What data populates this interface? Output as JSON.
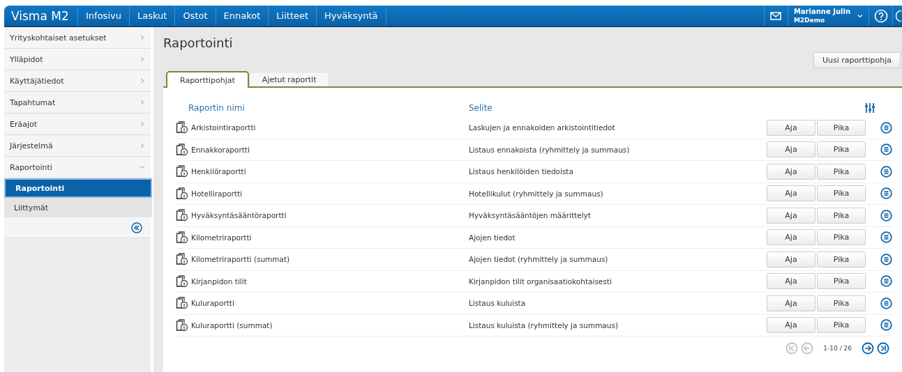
{
  "brand": "Visma M2",
  "nav": [
    {
      "label": "Infosivu"
    },
    {
      "label": "Laskut"
    },
    {
      "label": "Ostot"
    },
    {
      "label": "Ennakot"
    },
    {
      "label": "Liitteet"
    },
    {
      "label": "Hyväksyntä"
    }
  ],
  "user": {
    "name": "Marianne Julin",
    "company": "M2Demo"
  },
  "sidebar": {
    "items": [
      {
        "label": "Yrityskohtaiset asetukset",
        "expanded": false
      },
      {
        "label": "Ylläpidot",
        "expanded": false
      },
      {
        "label": "Käyttäjätiedot",
        "expanded": false
      },
      {
        "label": "Tapahtumat",
        "expanded": false
      },
      {
        "label": "Eräajot",
        "expanded": false
      },
      {
        "label": "Järjestelmä",
        "expanded": false
      },
      {
        "label": "Raportointi",
        "expanded": true,
        "children": [
          {
            "label": "Raportointi",
            "selected": true
          },
          {
            "label": "Liittymät",
            "selected": false
          }
        ]
      }
    ]
  },
  "page_title": "Raportointi",
  "new_button": "Uusi raporttipohja",
  "tabs": [
    {
      "label": "Raporttipohjat",
      "selected": true
    },
    {
      "label": "Ajetut raportit",
      "selected": false
    }
  ],
  "table": {
    "columns": [
      "Raportin nimi",
      "Selite"
    ],
    "rows": [
      {
        "name": "Arkistointiraportti",
        "description": "Laskujen ja ennakoiden arkistointitiedot",
        "run": "Aja",
        "quick": "Pika"
      },
      {
        "name": "Ennakkoraportti",
        "description": "Listaus ennakoista (ryhmittely ja summaus)",
        "run": "Aja",
        "quick": "Pika"
      },
      {
        "name": "Henkilöraportti",
        "description": "Listaus henkilöiden tiedoista",
        "run": "Aja",
        "quick": "Pika"
      },
      {
        "name": "Hotelliraportti",
        "description": "Hotellikulut (ryhmittely ja summaus)",
        "run": "Aja",
        "quick": "Pika"
      },
      {
        "name": "Hyväksyntäsääntöraportti",
        "description": "Hyväksyntäsääntöjen määrittelyt",
        "run": "Aja",
        "quick": "Pika"
      },
      {
        "name": "Kilometriraportti",
        "description": "Ajojen tiedot",
        "run": "Aja",
        "quick": "Pika"
      },
      {
        "name": "Kilometriraportti (summat)",
        "description": "Ajojen tiedot (ryhmittely ja summaus)",
        "run": "Aja",
        "quick": "Pika"
      },
      {
        "name": "Kirjanpidon tilit",
        "description": "Kirjanpidon tilit organisaatiokohtaisesti",
        "run": "Aja",
        "quick": "Pika"
      },
      {
        "name": "Kuluraportti",
        "description": "Listaus kuluista",
        "run": "Aja",
        "quick": "Pika"
      },
      {
        "name": "Kuluraportti (summat)",
        "description": "Listaus kuluista (ryhmittely ja summaus)",
        "run": "Aja",
        "quick": "Pika"
      }
    ]
  },
  "pagination": {
    "range": "1-10 / 26",
    "first_disabled": true,
    "prev_disabled": true,
    "next_disabled": false,
    "last_disabled": false
  }
}
